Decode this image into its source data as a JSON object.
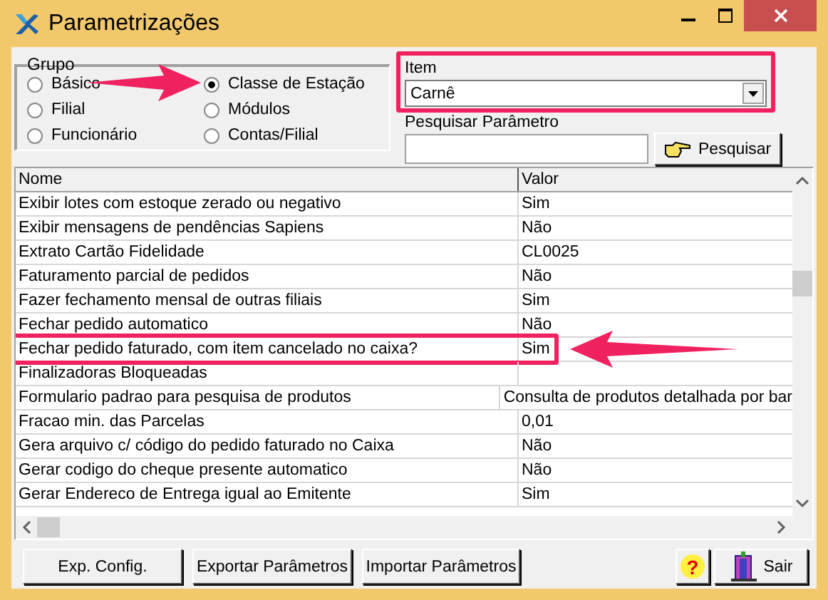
{
  "window": {
    "title": "Parametrizações"
  },
  "group": {
    "title": "Grupo",
    "options": [
      {
        "label": "Básico",
        "selected": false,
        "pointed": false
      },
      {
        "label": "Filial",
        "selected": false,
        "pointed": false
      },
      {
        "label": "Funcionário",
        "selected": false,
        "pointed": false
      },
      {
        "label": "Classe de Estação",
        "selected": true,
        "pointed": true
      },
      {
        "label": "Módulos",
        "selected": false,
        "pointed": false
      },
      {
        "label": "Contas/Filial",
        "selected": false,
        "pointed": false
      }
    ]
  },
  "item": {
    "label": "Item",
    "value": "Carnê",
    "highlighted": true
  },
  "search": {
    "label": "Pesquisar Parâmetro",
    "button": "Pesquisar"
  },
  "table": {
    "columns": [
      "Nome",
      "Valor"
    ],
    "rows": [
      {
        "name": "Exibir lotes com estoque zerado ou negativo",
        "value": "Sim",
        "highlighted": false
      },
      {
        "name": "Exibir mensagens de pendências Sapiens",
        "value": "Não",
        "highlighted": false
      },
      {
        "name": "Extrato Cartão Fidelidade",
        "value": "CL0025",
        "highlighted": false
      },
      {
        "name": "Faturamento parcial de pedidos",
        "value": "Não",
        "highlighted": false
      },
      {
        "name": "Fazer fechamento mensal de outras filiais",
        "value": "Sim",
        "highlighted": false
      },
      {
        "name": "Fechar pedido automatico",
        "value": "Não",
        "highlighted": false
      },
      {
        "name": "Fechar pedido faturado, com item cancelado no caixa?",
        "value": "Sim",
        "highlighted": true
      },
      {
        "name": "Finalizadoras Bloqueadas",
        "highlighted": false
      },
      {
        "name": "Formulario padrao para pesquisa de produtos",
        "value": "Consulta de produtos detalhada por bar",
        "highlighted": false
      },
      {
        "name": "Fracao min. das Parcelas",
        "value": "0,01",
        "highlighted": false
      },
      {
        "name": "Gera arquivo c/ código do pedido faturado no Caixa",
        "value": "Não",
        "highlighted": false
      },
      {
        "name": "Gerar codigo do cheque presente automatico",
        "value": "Não",
        "highlighted": false
      },
      {
        "name": "Gerar Endereco de Entrega igual ao Emitente",
        "value": "Sim",
        "highlighted": false
      }
    ]
  },
  "buttons": [
    {
      "label": "Exp. Config.",
      "kind": "text"
    },
    {
      "label": "Exportar Parâmetros",
      "kind": "text"
    },
    {
      "label": "Importar Parâmetros",
      "kind": "text"
    },
    {
      "label": "?",
      "kind": "help"
    },
    {
      "label": "Sair",
      "kind": "exit"
    }
  ]
}
